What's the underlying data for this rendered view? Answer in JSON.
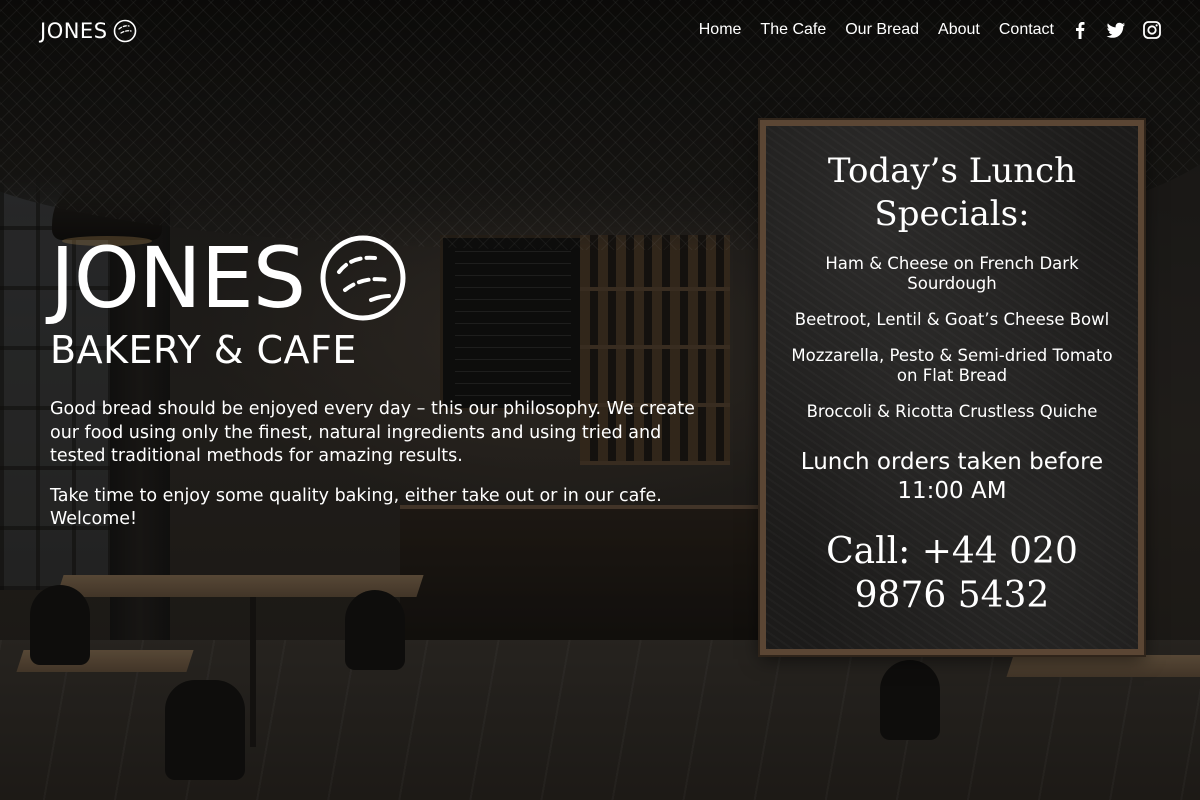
{
  "brand": {
    "name": "JONES"
  },
  "nav": {
    "links": [
      {
        "label": "Home"
      },
      {
        "label": "The Cafe"
      },
      {
        "label": "Our Bread"
      },
      {
        "label": "About"
      },
      {
        "label": "Contact"
      }
    ],
    "social": [
      {
        "icon": "facebook-icon"
      },
      {
        "icon": "twitter-icon"
      },
      {
        "icon": "instagram-icon"
      }
    ]
  },
  "hero": {
    "title": "JONES",
    "subtitle": "BAKERY & CAFE",
    "paragraphs": [
      "Good bread should be enjoyed every day – this our philosophy. We create our food using only the finest, natural ingredients and using tried and tested traditional methods for amazing results.",
      "Take time to enjoy some quality baking, either take out or in our cafe. Welcome!"
    ]
  },
  "specials": {
    "heading": "Today’s Lunch Specials:",
    "items": [
      "Ham & Cheese on French Dark Sourdough",
      "Beetroot, Lentil & Goat’s Cheese Bowl",
      "Mozzarella, Pesto & Semi-dried Tomato on Flat Bread",
      "Broccoli & Ricotta Crustless Quiche"
    ],
    "orders_note": "Lunch orders taken before 11:00 AM",
    "phone": "Call: +44 020 9876 5432"
  },
  "colors": {
    "text": "#ffffff",
    "board": "#1c1b1a",
    "board_frame": "#5b4634"
  }
}
